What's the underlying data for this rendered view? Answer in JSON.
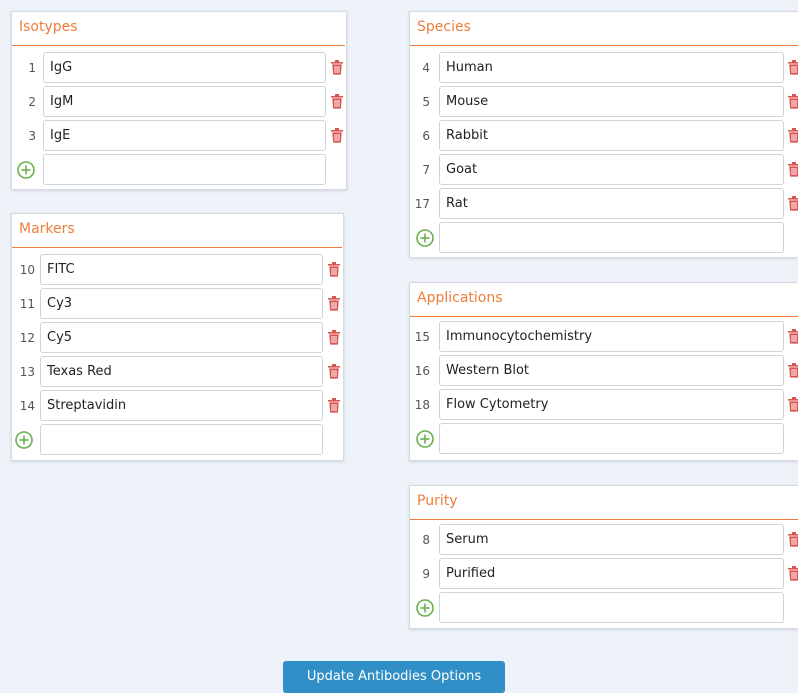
{
  "panels": {
    "isotypes": {
      "title": "Isotypes",
      "items": [
        {
          "num": "1",
          "value": "IgG"
        },
        {
          "num": "2",
          "value": "IgM"
        },
        {
          "num": "3",
          "value": "IgE"
        }
      ]
    },
    "markers": {
      "title": "Markers",
      "items": [
        {
          "num": "10",
          "value": "FITC"
        },
        {
          "num": "11",
          "value": "Cy3"
        },
        {
          "num": "12",
          "value": "Cy5"
        },
        {
          "num": "13",
          "value": "Texas Red"
        },
        {
          "num": "14",
          "value": "Streptavidin"
        }
      ]
    },
    "species": {
      "title": "Species",
      "items": [
        {
          "num": "4",
          "value": "Human"
        },
        {
          "num": "5",
          "value": "Mouse"
        },
        {
          "num": "6",
          "value": "Rabbit"
        },
        {
          "num": "7",
          "value": "Goat"
        },
        {
          "num": "17",
          "value": "Rat"
        }
      ]
    },
    "applications": {
      "title": "Applications",
      "items": [
        {
          "num": "15",
          "value": "Immunocytochemistry"
        },
        {
          "num": "16",
          "value": "Western Blot"
        },
        {
          "num": "18",
          "value": "Flow Cytometry"
        }
      ]
    },
    "purity": {
      "title": "Purity",
      "items": [
        {
          "num": "8",
          "value": "Serum"
        },
        {
          "num": "9",
          "value": "Purified"
        }
      ]
    }
  },
  "update_button": {
    "label": "Update Antibodies Options"
  },
  "colors": {
    "accent": "#ef7d3a",
    "delete": "#d9534f",
    "add": "#6ab04c",
    "button": "#2f8fc6"
  },
  "icons": {
    "delete": "trash-icon",
    "add": "plus-circle-icon"
  }
}
